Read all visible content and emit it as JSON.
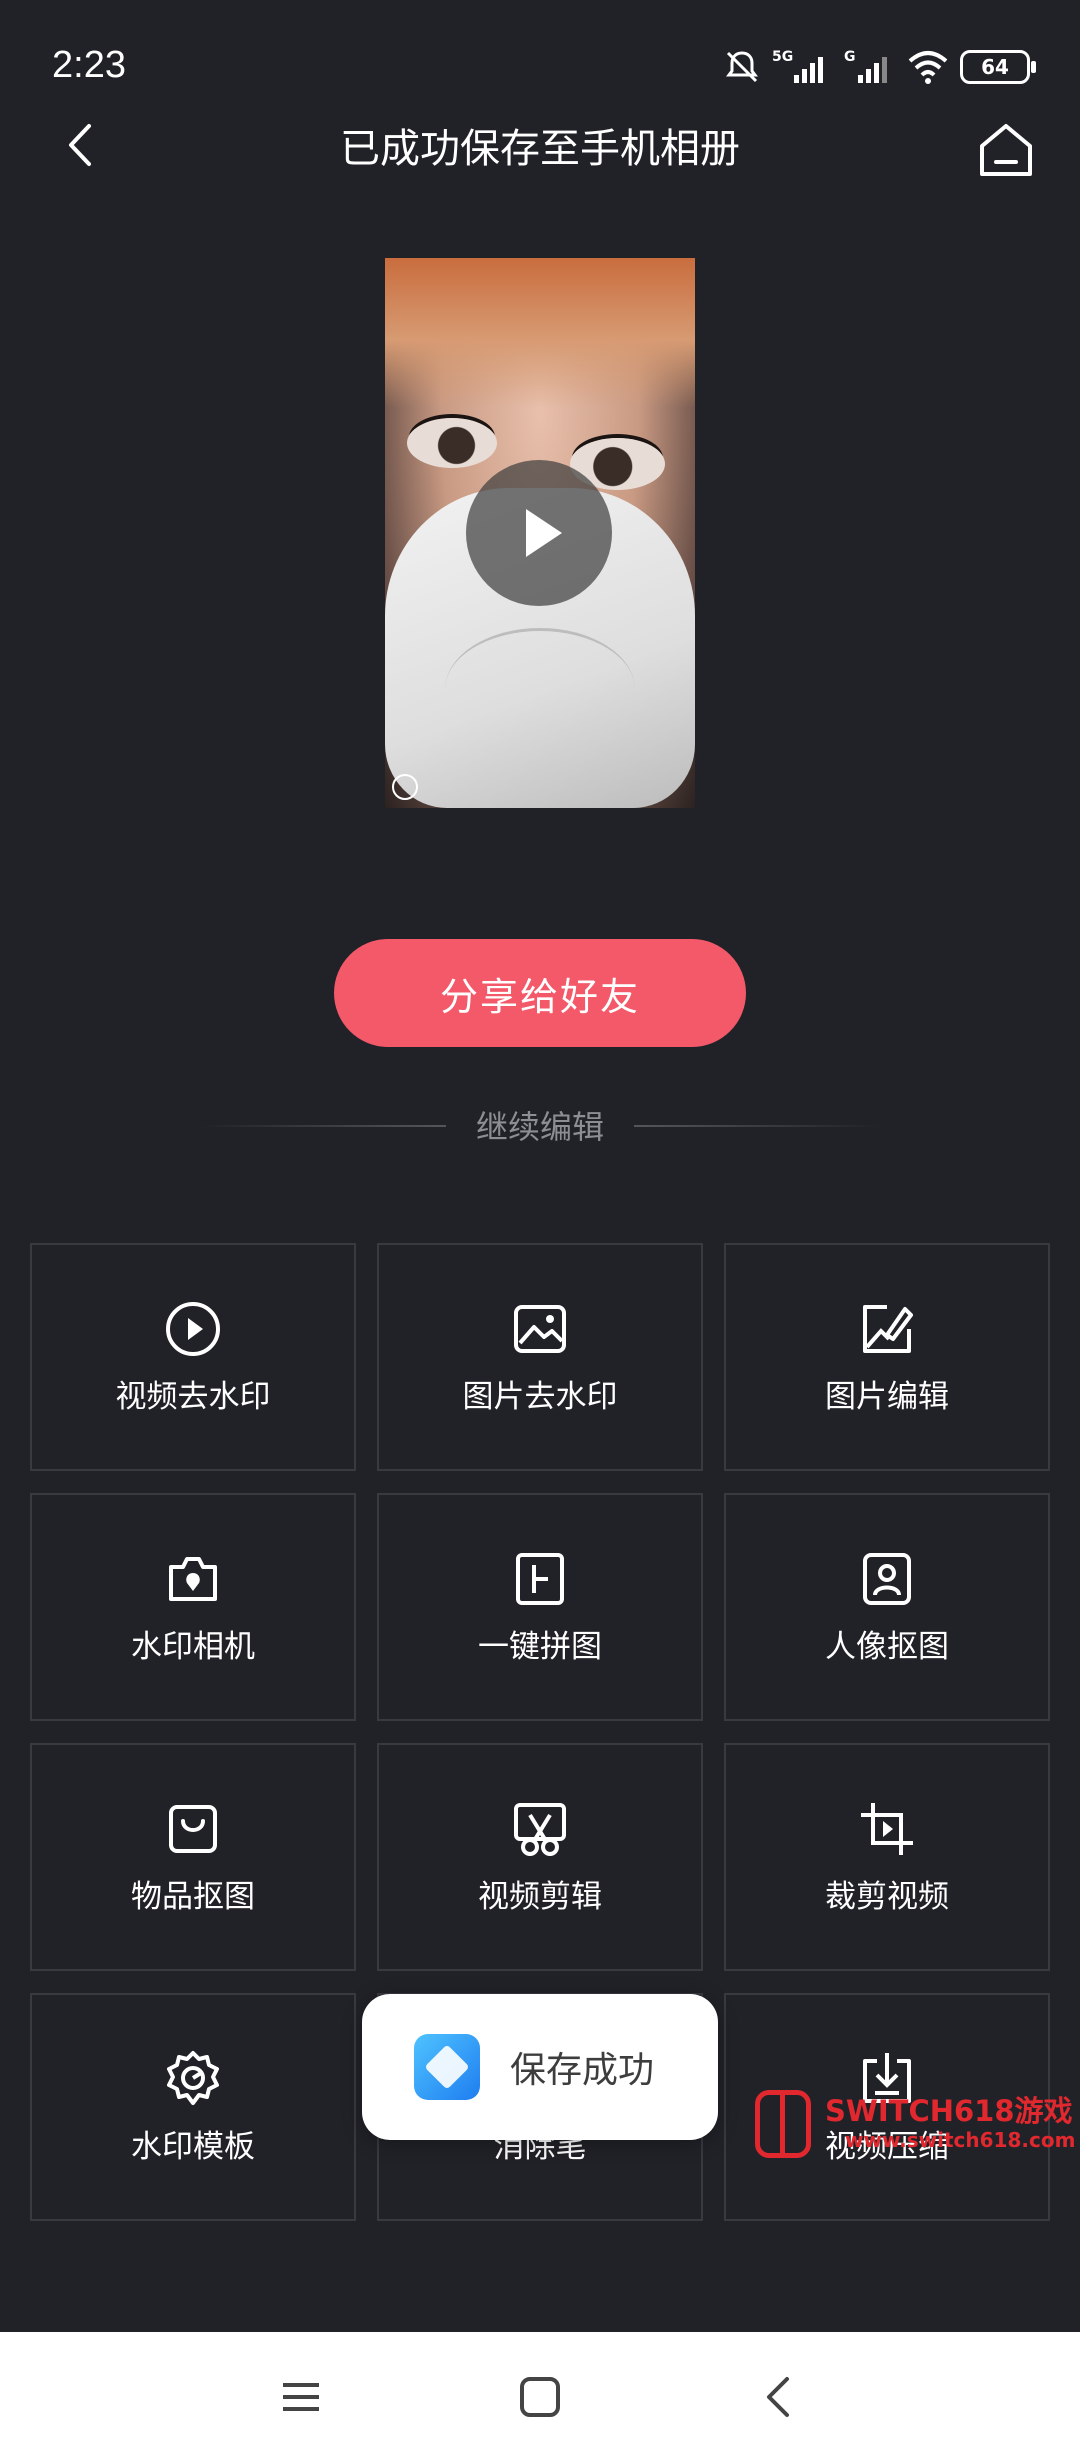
{
  "status_bar": {
    "time": "2:23",
    "battery": "64"
  },
  "header": {
    "title": "已成功保存至手机相册"
  },
  "share_button": "分享给好友",
  "divider_label": "继续编辑",
  "tools": [
    {
      "label": "视频去水印",
      "icon": "play-circle-icon"
    },
    {
      "label": "图片去水印",
      "icon": "image-icon"
    },
    {
      "label": "图片编辑",
      "icon": "image-edit-icon"
    },
    {
      "label": "水印相机",
      "icon": "camera-icon"
    },
    {
      "label": "一键拼图",
      "icon": "collage-icon"
    },
    {
      "label": "人像抠图",
      "icon": "portrait-icon"
    },
    {
      "label": "物品抠图",
      "icon": "bag-icon"
    },
    {
      "label": "视频剪辑",
      "icon": "scissors-icon"
    },
    {
      "label": "裁剪视频",
      "icon": "crop-icon"
    },
    {
      "label": "水印模板",
      "icon": "gear-icon"
    },
    {
      "label": "消除笔",
      "icon": "eraser-icon"
    },
    {
      "label": "视频压缩",
      "icon": "download-icon"
    }
  ],
  "toast": {
    "text": "保存成功"
  },
  "watermark": {
    "line1": "SWITCH618游戏",
    "line2": "www.switch618.com"
  },
  "colors": {
    "background": "#212228",
    "accent": "#f4596a",
    "cell_border": "#393a40"
  }
}
